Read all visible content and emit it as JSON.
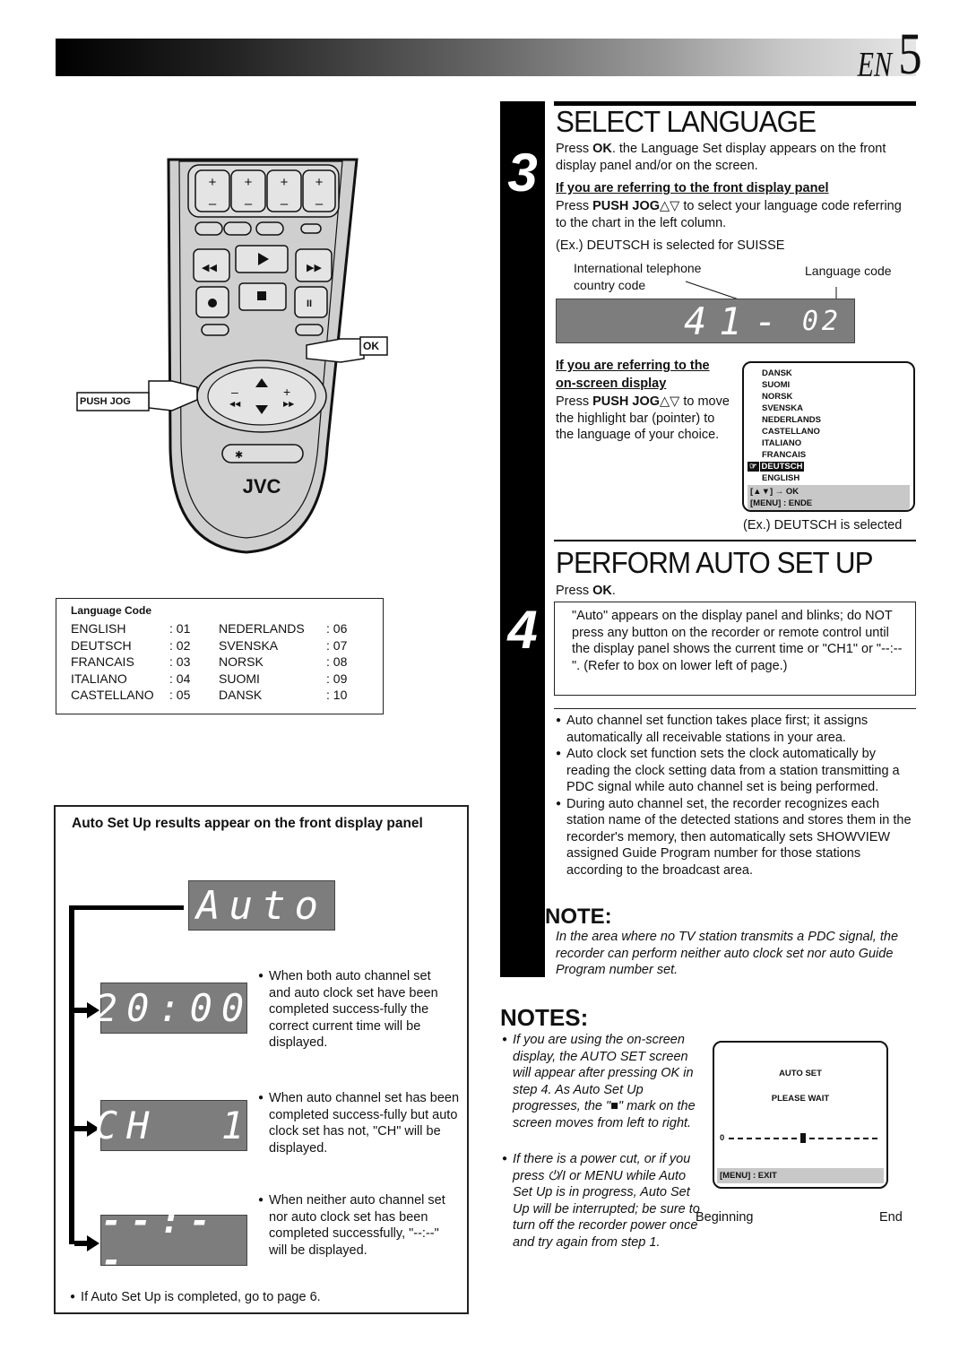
{
  "header": {
    "lang_tag": "EN",
    "page_number": "5"
  },
  "remote": {
    "brand": "JVC",
    "callouts": {
      "ok": "OK",
      "push_jog": "PUSH JOG"
    }
  },
  "language_table": {
    "title": "Language Code",
    "rows": [
      {
        "left_name": "ENGLISH",
        "left_code": ": 01",
        "right_name": "NEDERLANDS",
        "right_code": ": 06"
      },
      {
        "left_name": "DEUTSCH",
        "left_code": ": 02",
        "right_name": "SVENSKA",
        "right_code": ": 07"
      },
      {
        "left_name": "FRANCAIS",
        "left_code": ": 03",
        "right_name": "NORSK",
        "right_code": ": 08"
      },
      {
        "left_name": "ITALIANO",
        "left_code": ": 04",
        "right_name": "SUOMI",
        "right_code": ": 09"
      },
      {
        "left_name": "CASTELLANO",
        "left_code": ": 05",
        "right_name": "DANSK",
        "right_code": ": 10"
      }
    ]
  },
  "results_box": {
    "title": "Auto Set Up results appear on the front display panel",
    "auto_display": "Auto",
    "cases": [
      {
        "display": "20:00",
        "text": "When both auto channel set and auto clock set have been completed success-fully the correct current time will be displayed."
      },
      {
        "display": "CH  1",
        "text": "When auto channel set has been completed success-fully but auto clock set has not, \"CH\" will be displayed."
      },
      {
        "display": "--:--",
        "text": "When neither auto channel set nor auto clock set has been completed successfully, \"--:--\" will be displayed."
      }
    ],
    "footer": "If Auto Set Up is completed, go to page 6."
  },
  "step3": {
    "number": "3",
    "title": "SELECT LANGUAGE",
    "intro_pre": "Press ",
    "intro_key": "OK",
    "intro_post": ". the Language Set display appears on the front display panel and/or on the screen.",
    "front_heading": "If you are referring to the front display panel",
    "front_pre": "Press ",
    "front_key": "PUSH JOG",
    "front_post": "△▽ to select your language code referring to the chart in the left column.",
    "front_example": "(Ex.) DEUTSCH is selected for SUISSE",
    "label_country": "International telephone country code",
    "label_language": "Language code",
    "lcd_country": "41-",
    "lcd_language": "02",
    "screen_heading": "If you are referring to the on-screen display",
    "screen_pre": "Press ",
    "screen_key": "PUSH JOG",
    "screen_post": "△▽ to move the highlight bar (pointer) to the language of your choice.",
    "osd_languages": [
      "DANSK",
      "SUOMI",
      "NORSK",
      "SVENSKA",
      "NEDERLANDS",
      "CASTELLANO",
      "ITALIANO",
      "FRANCAIS",
      "DEUTSCH",
      "ENGLISH"
    ],
    "osd_selected": "DEUTSCH",
    "osd_foot1": "[▲▼] → OK",
    "osd_foot2": "[MENU] : ENDE",
    "screen_example": "(Ex.) DEUTSCH is selected"
  },
  "step4": {
    "number": "4",
    "title": "PERFORM AUTO SET UP",
    "press_pre": "Press ",
    "press_key": "OK",
    "press_post": ".",
    "boxed": "\"Auto\" appears on the display panel and blinks; do NOT press any button on the recorder or remote control until the display panel shows the current time or \"CH1\" or \"--:--\". (Refer to box on lower left of page.)",
    "bullets": [
      "Auto channel set function takes place first; it assigns automatically all receivable stations in your area.",
      "Auto clock set function sets the clock automatically by reading the clock setting data from a station transmitting a PDC signal while auto channel set is being performed.",
      "During auto channel set, the recorder recognizes each station name of the detected stations and stores them in the recorder's memory, then automatically sets SHOWVIEW assigned Guide Program number for those stations according to the broadcast area."
    ]
  },
  "note": {
    "title": "NOTE:",
    "text": "In the area where no TV station transmits a PDC signal, the recorder can perform neither auto clock set nor auto Guide Program number set."
  },
  "notes": {
    "title": "NOTES:",
    "bullet1": "If you are using the on-screen display, the AUTO SET screen will appear after pressing OK in step 4. As Auto Set Up progresses, the \"■\" mark on the screen moves from left to right.",
    "bullet2": "If there is a power cut, or if you press ⏻/I or MENU while Auto Set Up is in progress, Auto Set Up will be interrupted; be sure to turn off the recorder power once and try again from step 1.",
    "osd_title": "AUTO SET",
    "osd_wait": "PLEASE WAIT",
    "osd_scale_start": "0",
    "osd_progress": 0.5,
    "osd_foot": "[MENU] : EXIT",
    "label_begin": "Beginning",
    "label_end": "End"
  }
}
